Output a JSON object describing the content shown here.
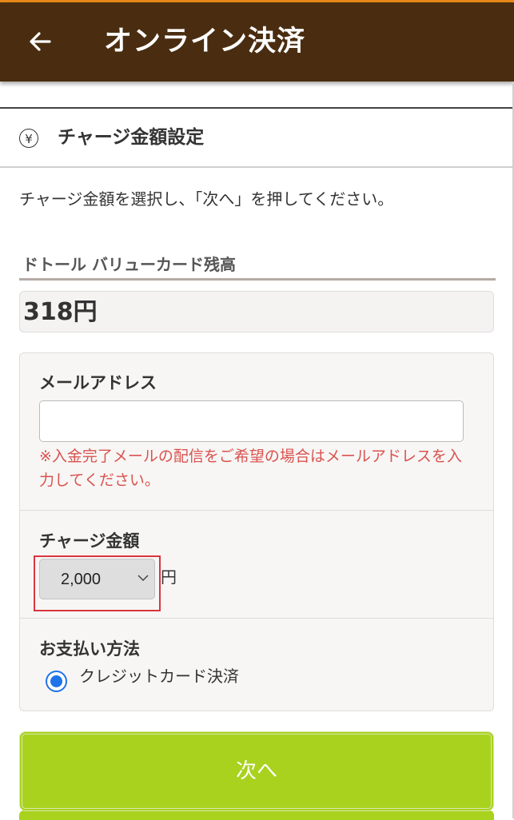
{
  "appbar": {
    "title": "オンライン決済"
  },
  "section": {
    "title": "チャージ金額設定",
    "icon": "yen-icon"
  },
  "instruction": "チャージ金額を選択し、「次へ」を押してください。",
  "balance": {
    "label": "ドトール バリューカード残高",
    "value": "318円"
  },
  "form": {
    "email_label": "メールアドレス",
    "email_value": "",
    "email_placeholder": "",
    "email_note": "※入金完了メールの配信をご希望の場合はメールアドレスを入力してください。",
    "charge_label": "チャージ金額",
    "charge_selected": "2,000",
    "charge_unit": "円",
    "payment_label": "お支払い方法",
    "payment_option": "クレジットカード決済"
  },
  "next_button": {
    "label": "次へ"
  },
  "colors": {
    "appbar": "#4a2d10",
    "accent_top": "#e8891a",
    "button": "#a8d21e",
    "note": "#d9534f",
    "highlight": "#d9363e",
    "radio": "#1e73e8"
  }
}
